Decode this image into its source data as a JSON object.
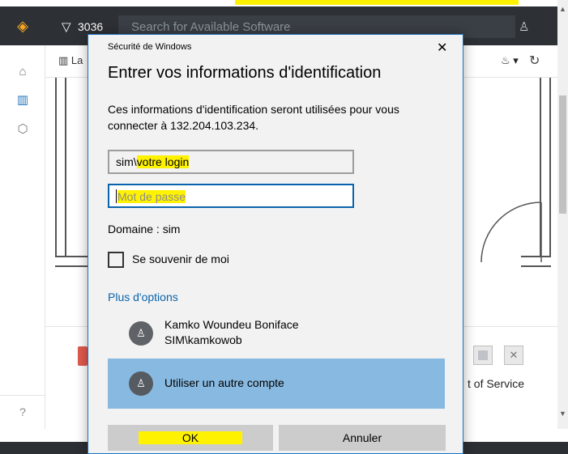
{
  "app": {
    "count": "3036",
    "search_placeholder": "Search for Available Software",
    "toolbar": {
      "map_label": "La"
    },
    "footer": {
      "tos_text": "t of Service"
    }
  },
  "dialog": {
    "caption": "Sécurité de Windows",
    "close": "✕",
    "title": "Entrer vos informations d'identification",
    "message": "Ces informations d'identification seront utilisées pour vous connecter à 132.204.103.234.",
    "login_prefix": "sim\\",
    "login_value": "votre login",
    "password_placeholder": "Mot de passe",
    "domain_label": "Domaine : sim",
    "remember_label": "Se souvenir de moi",
    "more_options": "Plus d'options",
    "accounts": [
      {
        "name": "Kamko Woundeu Boniface",
        "user": "SIM\\kamkowob"
      },
      {
        "name": "Utiliser un autre compte"
      }
    ],
    "ok_label": "OK",
    "cancel_label": "Annuler"
  },
  "colors": {
    "topbar": "#2d3136",
    "highlight": "#fff200",
    "accent": "#0a64ad",
    "selected_account": "#88b9e0"
  },
  "icons": [
    "app-logo-icon",
    "filter-icon",
    "user-icon",
    "home-icon",
    "map-icon",
    "box-icon",
    "fire-icon",
    "refresh-icon",
    "help-icon",
    "avatar-icon",
    "close-icon"
  ]
}
